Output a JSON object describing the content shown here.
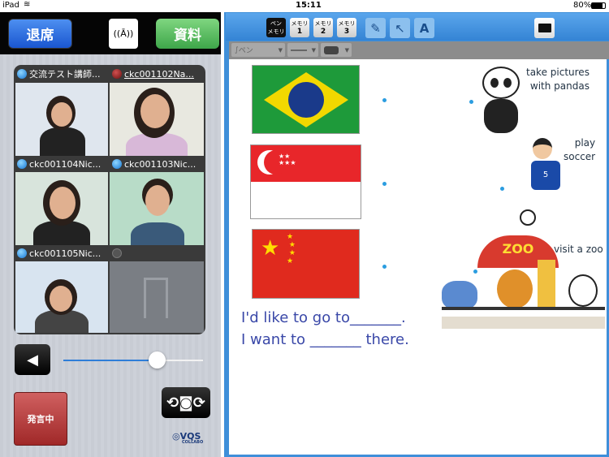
{
  "status_bar": {
    "device": "iPad",
    "time": "15:11",
    "battery": "80%"
  },
  "header": {
    "exit_label": "退席",
    "docs_label": "資料",
    "antenna_icon": "antenna-icon"
  },
  "participants": [
    {
      "name": "交流テスト講師...",
      "status": "blue"
    },
    {
      "name": "ckc001102Na...",
      "status": "red"
    },
    {
      "name": "ckc001104Nic...",
      "status": "blue"
    },
    {
      "name": "ckc001103Nic...",
      "status": "blue"
    },
    {
      "name": "ckc001105Nic...",
      "status": "blue"
    },
    {
      "name": "",
      "status": "grey"
    }
  ],
  "controls": {
    "volume": 0.67,
    "talk_label": "発言中",
    "logo": "VQS",
    "logo_sub": "COLLABO"
  },
  "whiteboard": {
    "toolbar": {
      "pen_memo_top": "ペン",
      "pen_memo_bottom": "メモリ",
      "memo_label": "メモリ",
      "memos": [
        "1",
        "2",
        "3"
      ]
    },
    "pen_type": "ペン",
    "sentences": [
      "I'd like to go to_______.",
      "I want to _______ there."
    ],
    "captions": [
      "take pictures\nwith pandas",
      "play\nsoccer",
      "visit a zoo"
    ],
    "zoo_sign": "ZOO"
  }
}
